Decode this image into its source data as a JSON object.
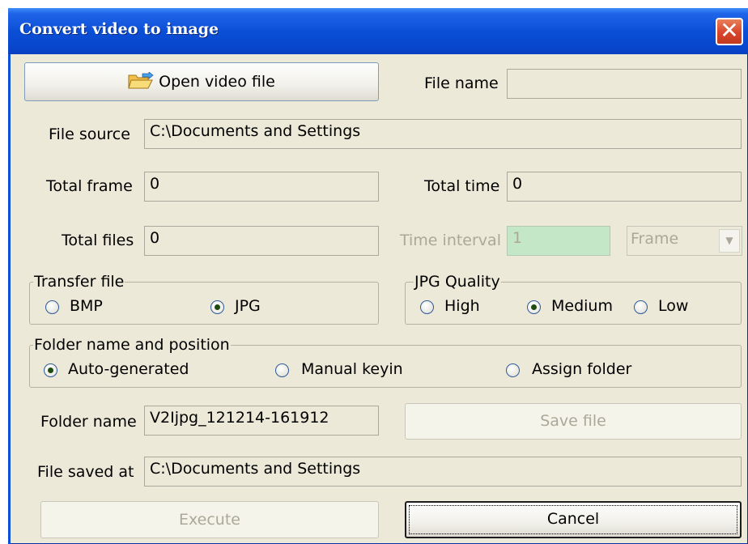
{
  "window": {
    "title": "Convert video to image",
    "close_label": "✕"
  },
  "open_button": {
    "label": "Open video file",
    "icon": "open-folder-icon"
  },
  "file_name": {
    "label": "File name",
    "value": ""
  },
  "file_source": {
    "label": "File source",
    "value": "C:\\Documents and Settings"
  },
  "total_frame": {
    "label": "Total frame",
    "value": "0"
  },
  "total_time": {
    "label": "Total time",
    "value": "0"
  },
  "total_files": {
    "label": "Total files",
    "value": "0"
  },
  "time_interval": {
    "label": "Time interval",
    "value": "1",
    "unit_selected": "Frame"
  },
  "transfer_file": {
    "legend": "Transfer file",
    "options": [
      {
        "label": "BMP",
        "checked": false
      },
      {
        "label": "JPG",
        "checked": true
      }
    ]
  },
  "jpg_quality": {
    "legend": "JPG Quality",
    "options": [
      {
        "label": "High",
        "checked": false
      },
      {
        "label": "Medium",
        "checked": true
      },
      {
        "label": "Low",
        "checked": false
      }
    ]
  },
  "folder_position": {
    "legend": "Folder name and position",
    "options": [
      {
        "label": "Auto-generated",
        "checked": true
      },
      {
        "label": "Manual keyin",
        "checked": false
      },
      {
        "label": "Assign folder",
        "checked": false
      }
    ]
  },
  "folder_name": {
    "label": "Folder name",
    "value": "V2Ijpg_121214-161912"
  },
  "save_file": {
    "label": "Save file"
  },
  "file_saved_at": {
    "label": "File saved at",
    "value": "C:\\Documents and Settings"
  },
  "execute": {
    "label": "Execute"
  },
  "cancel": {
    "label": "Cancel"
  }
}
